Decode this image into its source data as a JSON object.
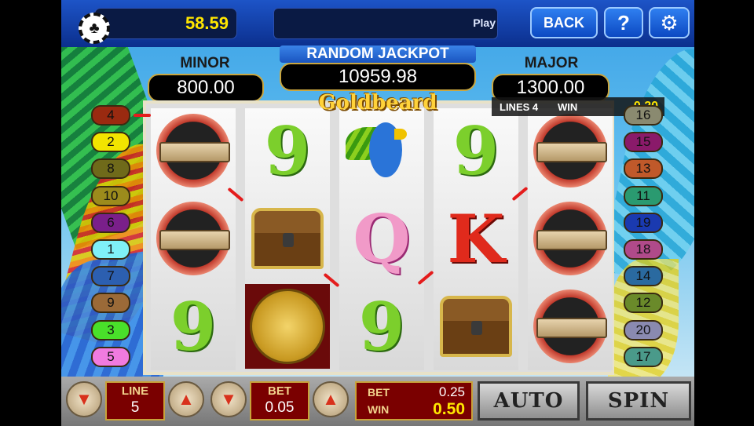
{
  "top_bar": {
    "balance": "58.59",
    "marquee": "Play",
    "back_label": "BACK",
    "help_label": "?",
    "chip_icon": "club-icon",
    "settings_icon": "gear-icon"
  },
  "jackpots": {
    "minor_label": "MINOR",
    "minor_value": "800.00",
    "random_label": "RANDOM JACKPOT",
    "random_value": "10959.98",
    "major_label": "MAJOR",
    "major_value": "1300.00"
  },
  "logo_text": "Goldbeard",
  "win_bar": {
    "lines_label": "LINES 4",
    "win_label": "WIN",
    "win_value": "0.20"
  },
  "reels": [
    [
      "hatch",
      "hatch",
      "nine"
    ],
    [
      "nine",
      "chest",
      "coin"
    ],
    [
      "parrot",
      "Q",
      "nine"
    ],
    [
      "nine",
      "K",
      "chest"
    ],
    [
      "hatch",
      "hatch",
      "hatch"
    ]
  ],
  "left_lines": [
    {
      "n": "4",
      "color": "#9a2a10"
    },
    {
      "n": "2",
      "color": "#f2e400"
    },
    {
      "n": "8",
      "color": "#6f6a1a"
    },
    {
      "n": "10",
      "color": "#9c8b1c"
    },
    {
      "n": "6",
      "color": "#7a1f8a"
    },
    {
      "n": "1",
      "color": "#7ff0f8"
    },
    {
      "n": "7",
      "color": "#2c5fb0"
    },
    {
      "n": "9",
      "color": "#9b6a38"
    },
    {
      "n": "3",
      "color": "#49e02a"
    },
    {
      "n": "5",
      "color": "#f07be0"
    }
  ],
  "right_lines": [
    {
      "n": "16",
      "color": "#8a8a70"
    },
    {
      "n": "15",
      "color": "#8a1a6a"
    },
    {
      "n": "13",
      "color": "#c0592a"
    },
    {
      "n": "11",
      "color": "#2a9a70"
    },
    {
      "n": "19",
      "color": "#1a3ab0"
    },
    {
      "n": "18",
      "color": "#b04a8a"
    },
    {
      "n": "14",
      "color": "#2a6aa0"
    },
    {
      "n": "12",
      "color": "#6a8a2a"
    },
    {
      "n": "20",
      "color": "#8a8ab0"
    },
    {
      "n": "17",
      "color": "#4a9a8a"
    }
  ],
  "bottom": {
    "line_label": "LINE",
    "line_value": "5",
    "bet_label": "BET",
    "bet_value": "0.05",
    "total_bet_label": "BET",
    "total_bet_value": "0.25",
    "win_label": "WIN",
    "win_value": "0.50",
    "auto_label": "AUTO",
    "spin_label": "SPIN"
  }
}
